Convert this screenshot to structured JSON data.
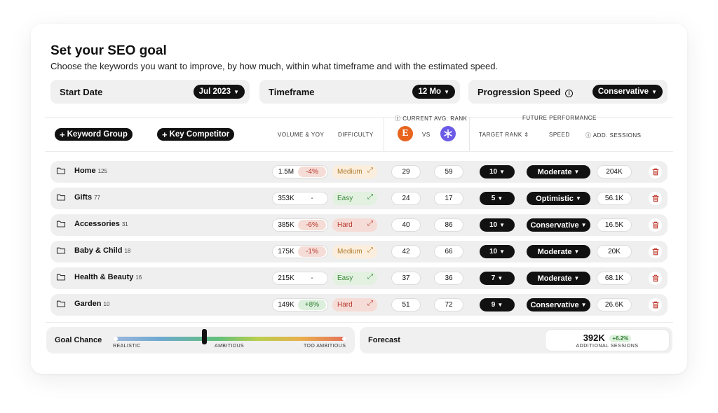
{
  "header": {
    "title": "Set your SEO goal",
    "subtitle": "Choose the keywords you want to improve, by how much, within what timeframe and with the estimated speed."
  },
  "settings": {
    "start_date": {
      "label": "Start Date",
      "value": "Jul 2023"
    },
    "timeframe": {
      "label": "Timeframe",
      "value": "12 Mo"
    },
    "progression_speed": {
      "label": "Progression Speed",
      "value": "Conservative"
    }
  },
  "toolbar": {
    "keyword_group_label": "Keyword Group",
    "key_competitor_label": "Key Competitor"
  },
  "columns": {
    "volume_yoy": "VOLUME & YOY",
    "difficulty": "DIFFICULTY",
    "current_avg_rank": "CURRENT AVG. RANK",
    "vs": "VS",
    "future_performance": "FUTURE PERFORMANCE",
    "target_rank": "TARGET RANK",
    "speed": "SPEED",
    "add_sessions": "ADD. SESSIONS"
  },
  "competitors": {
    "own_logo_letter": "E",
    "own_color": "#e8641e",
    "competitor_color": "#6b5be6"
  },
  "colors": {
    "yoy_negative_bg": "#f6dcd6",
    "yoy_negative_fg": "#b4372b",
    "yoy_positive_bg": "#dcefdc",
    "yoy_positive_fg": "#2f7d33",
    "diff_medium_bg": "#fbeedd",
    "diff_medium_fg": "#b07a2e",
    "diff_easy_bg": "#e2f1e0",
    "diff_easy_fg": "#3d8a3d",
    "diff_hard_bg": "#f6dcd6",
    "diff_hard_fg": "#b4372b"
  },
  "rows": [
    {
      "name": "Home",
      "count": "125",
      "volume": "1.5M",
      "yoy": "-4%",
      "yoy_trend": "negative",
      "difficulty": "Medium",
      "difficulty_level": "medium",
      "current_rank": "29",
      "competitor_rank": "59",
      "target_rank": "10",
      "speed": "Moderate",
      "sessions": "204K"
    },
    {
      "name": "Gifts",
      "count": "77",
      "volume": "353K",
      "yoy": "-",
      "yoy_trend": "neutral",
      "difficulty": "Easy",
      "difficulty_level": "easy",
      "current_rank": "24",
      "competitor_rank": "17",
      "target_rank": "5",
      "speed": "Optimistic",
      "sessions": "56.1K"
    },
    {
      "name": "Accessories",
      "count": "31",
      "volume": "385K",
      "yoy": "-6%",
      "yoy_trend": "negative",
      "difficulty": "Hard",
      "difficulty_level": "hard",
      "current_rank": "40",
      "competitor_rank": "86",
      "target_rank": "10",
      "speed": "Conservative",
      "sessions": "16.5K"
    },
    {
      "name": "Baby & Child",
      "count": "18",
      "volume": "175K",
      "yoy": "-1%",
      "yoy_trend": "negative",
      "difficulty": "Medium",
      "difficulty_level": "medium",
      "current_rank": "42",
      "competitor_rank": "66",
      "target_rank": "10",
      "speed": "Moderate",
      "sessions": "20K"
    },
    {
      "name": "Health & Beauty",
      "count": "16",
      "volume": "215K",
      "yoy": "-",
      "yoy_trend": "neutral",
      "difficulty": "Easy",
      "difficulty_level": "easy",
      "current_rank": "37",
      "competitor_rank": "36",
      "target_rank": "7",
      "speed": "Moderate",
      "sessions": "68.1K"
    },
    {
      "name": "Garden",
      "count": "10",
      "volume": "149K",
      "yoy": "+8%",
      "yoy_trend": "positive",
      "difficulty": "Hard",
      "difficulty_level": "hard",
      "current_rank": "51",
      "competitor_rank": "72",
      "target_rank": "9",
      "speed": "Conservative",
      "sessions": "26.6K"
    }
  ],
  "goal_chance": {
    "label": "Goal Chance",
    "level_fraction": 0.39,
    "ticks": {
      "realistic": "REALISTIC",
      "ambitious": "AMBITIOUS",
      "too_ambitious": "TOO AMBITIOUS"
    }
  },
  "forecast": {
    "label": "Forecast",
    "value": "392K",
    "change": "+6.2%",
    "sub": "ADDITIONAL SESSIONS"
  }
}
